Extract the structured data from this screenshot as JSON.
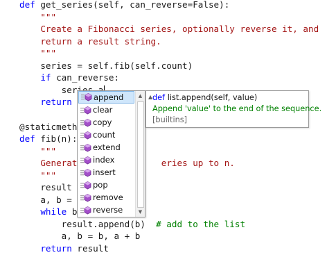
{
  "editor": {
    "lines": [
      {
        "segments": [
          {
            "t": "def",
            "c": "kw"
          },
          {
            "t": " get_series(self, can_reverse=False):",
            "c": ""
          }
        ]
      },
      {
        "segments": [
          {
            "t": "    \"\"\"",
            "c": "str"
          }
        ]
      },
      {
        "segments": [
          {
            "t": "    Create a Fibonacci series, optionally reverse it, and",
            "c": "str"
          }
        ]
      },
      {
        "segments": [
          {
            "t": "    return a result string.",
            "c": "str"
          }
        ]
      },
      {
        "segments": [
          {
            "t": "    \"\"\"",
            "c": "str"
          }
        ]
      },
      {
        "segments": [
          {
            "t": "    series = self.fib(self.count)",
            "c": ""
          }
        ]
      },
      {
        "segments": [
          {
            "t": "    ",
            "c": ""
          },
          {
            "t": "if",
            "c": "kw"
          },
          {
            "t": " can_reverse:",
            "c": ""
          }
        ]
      },
      {
        "segments": [
          {
            "t": "        series.a",
            "c": ""
          }
        ],
        "caret": true
      },
      {
        "segments": [
          {
            "t": "    ",
            "c": ""
          },
          {
            "t": "return",
            "c": "kw"
          },
          {
            "t": " '",
            "c": "str"
          }
        ]
      },
      {
        "segments": [
          {
            "t": "",
            "c": ""
          }
        ]
      },
      {
        "segments": [
          {
            "t": "@staticmetho",
            "c": ""
          }
        ]
      },
      {
        "segments": [
          {
            "t": "def",
            "c": "kw"
          },
          {
            "t": " fib(n):",
            "c": ""
          }
        ]
      },
      {
        "segments": [
          {
            "t": "    \"\"\"",
            "c": "str"
          }
        ]
      },
      {
        "segments": [
          {
            "t": "    Generate",
            "c": "str"
          },
          {
            "t": "               ",
            "c": ""
          },
          {
            "t": "eries up to n.",
            "c": "str"
          }
        ]
      },
      {
        "segments": [
          {
            "t": "    \"\"\"",
            "c": "str"
          }
        ]
      },
      {
        "segments": [
          {
            "t": "    result =",
            "c": ""
          }
        ]
      },
      {
        "segments": [
          {
            "t": "    a, b = 0",
            "c": ""
          }
        ]
      },
      {
        "segments": [
          {
            "t": "    ",
            "c": ""
          },
          {
            "t": "while",
            "c": "kw"
          },
          {
            "t": " b",
            "c": ""
          }
        ]
      },
      {
        "segments": [
          {
            "t": "        result.append(b)  ",
            "c": ""
          },
          {
            "t": "# add to the list",
            "c": "cmt"
          }
        ]
      },
      {
        "segments": [
          {
            "t": "        a, b = b, a + b",
            "c": ""
          }
        ]
      },
      {
        "segments": [
          {
            "t": "    ",
            "c": ""
          },
          {
            "t": "return",
            "c": "kw"
          },
          {
            "t": " result",
            "c": ""
          }
        ]
      }
    ]
  },
  "completion": {
    "items": [
      {
        "label": "append",
        "icon": "method-icon",
        "selected": true
      },
      {
        "label": "clear",
        "icon": "method-icon"
      },
      {
        "label": "copy",
        "icon": "method-icon"
      },
      {
        "label": "count",
        "icon": "method-icon"
      },
      {
        "label": "extend",
        "icon": "method-icon"
      },
      {
        "label": "index",
        "icon": "method-icon"
      },
      {
        "label": "insert",
        "icon": "method-icon"
      },
      {
        "label": "pop",
        "icon": "method-icon"
      },
      {
        "label": "remove",
        "icon": "method-icon"
      },
      {
        "label": "reverse",
        "icon": "method-icon"
      }
    ],
    "scroll_up_glyph": "▲",
    "scroll_down_glyph": "▼"
  },
  "tooltip": {
    "keyword": "def",
    "signature": "list.append(self, value)",
    "doc": "Append 'value' to the end of the sequence.",
    "source": "[builtins]",
    "pin_glyph": "▲"
  },
  "colors": {
    "keyword": "#0000ff",
    "string": "#a31515",
    "comment": "#008000",
    "selection": "#cfe6fb",
    "method_icon": "#a34fc9"
  }
}
